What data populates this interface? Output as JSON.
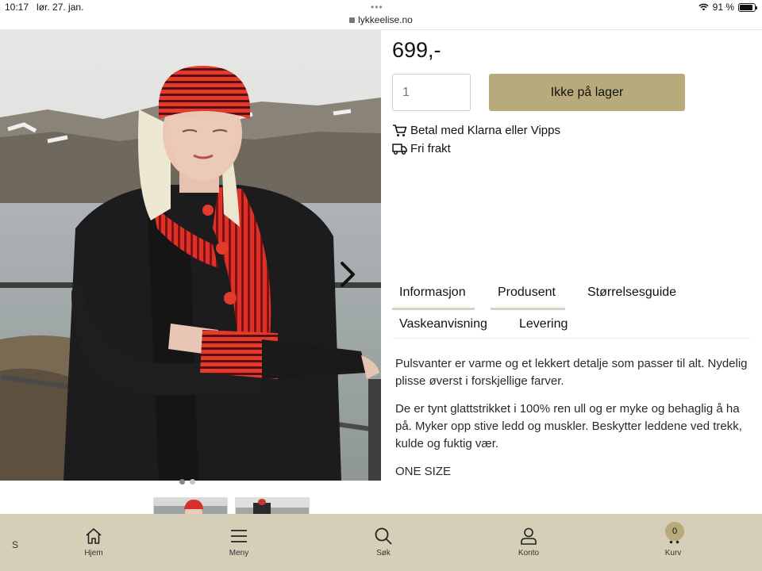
{
  "status_bar": {
    "time": "10:17",
    "date": "lør. 27. jan.",
    "url": "lykkeelise.no",
    "battery": "91 %",
    "battery_level": 0.91
  },
  "gallery": {
    "images": 2,
    "active_index": 0,
    "next_icon": "chevron-right-icon"
  },
  "product": {
    "price": "699,-",
    "quantity": "1",
    "stock_button": "Ikke på lager",
    "perks": [
      {
        "icon": "cart-icon",
        "label": "Betal med Klarna eller Vipps"
      },
      {
        "icon": "truck-icon",
        "label": "Fri frakt"
      }
    ]
  },
  "tabs": [
    {
      "label": "Informasjon",
      "underlined": true
    },
    {
      "label": "Produsent",
      "underlined": true
    },
    {
      "label": "Størrelsesguide",
      "underlined": false
    },
    {
      "label": "Vaskeanvisning",
      "underlined": false
    },
    {
      "label": "Levering",
      "underlined": false
    }
  ],
  "description": {
    "p1": "Pulsvanter er varme og et lekkert detalje som passer til alt. Nydelig plisse øverst i forskjellige farver.",
    "p2": "De er tynt glattstrikket i 100% ren ull og er myke og behaglig å ha på. Myker opp stive ledd og muskler. Beskytter leddene ved trekk, kulde og fuktig vær.",
    "p3": "ONE SIZE"
  },
  "bottom_nav": {
    "left_letter": "S",
    "items": [
      {
        "icon": "home-icon",
        "label": "Hjem"
      },
      {
        "icon": "menu-icon",
        "label": "Meny"
      },
      {
        "icon": "search-icon",
        "label": "Søk"
      },
      {
        "icon": "user-icon",
        "label": "Konto"
      },
      {
        "icon": "cart-icon",
        "label": "Kurv"
      }
    ],
    "cart_count": "0"
  },
  "colors": {
    "accent": "#b8aa7a",
    "nav_bg": "#d6cfb8",
    "tab_underline": "#d9d2bd"
  }
}
